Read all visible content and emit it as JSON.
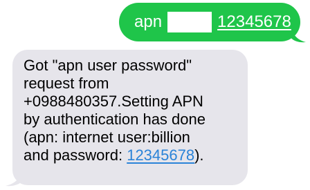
{
  "thread": {
    "outgoing": {
      "word": "apn",
      "password": "12345678",
      "bubble_color": "#1fc54a"
    },
    "incoming": {
      "lines": [
        "Got \"apn user password\"",
        "request from",
        "+0988480357.Setting APN",
        "by authentication has done",
        "(apn: internet user:billion"
      ],
      "last_line_prefix": "and password: ",
      "last_line_link": "12345678",
      "last_line_suffix": ").",
      "bubble_color": "#e6e5eb",
      "link_color": "#2a83d8"
    }
  }
}
